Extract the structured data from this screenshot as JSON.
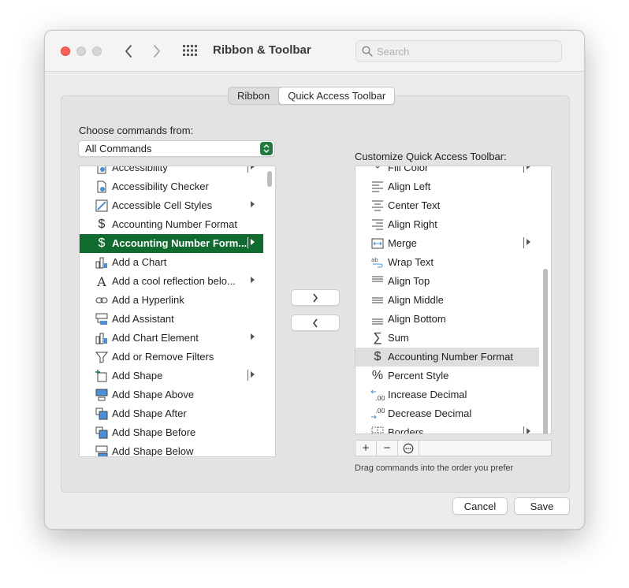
{
  "window": {
    "title": "Ribbon & Toolbar",
    "search_placeholder": "Search"
  },
  "tabs": [
    {
      "label": "Ribbon",
      "active": false
    },
    {
      "label": "Quick Access Toolbar",
      "active": true
    }
  ],
  "left": {
    "choose_label": "Choose commands from:",
    "selected_source": "All Commands",
    "items": [
      {
        "label": "Accessibility",
        "icon": "accessibility-icon",
        "submenu": "bar"
      },
      {
        "label": "Accessibility Checker",
        "icon": "accessibility-checker-icon",
        "submenu": "none"
      },
      {
        "label": "Accessible Cell Styles",
        "icon": "cell-styles-icon",
        "submenu": "arrow"
      },
      {
        "label": "Accounting Number Format",
        "icon": "dollar-icon",
        "submenu": "none"
      },
      {
        "label": "Accounting Number Form...",
        "icon": "dollar-icon",
        "submenu": "bar",
        "selected": true
      },
      {
        "label": "Add a Chart",
        "icon": "chart-icon",
        "submenu": "none"
      },
      {
        "label": "Add a cool reflection belo...",
        "icon": "text-effects-icon",
        "submenu": "arrow"
      },
      {
        "label": "Add a Hyperlink",
        "icon": "hyperlink-icon",
        "submenu": "none"
      },
      {
        "label": "Add Assistant",
        "icon": "assistant-icon",
        "submenu": "none"
      },
      {
        "label": "Add Chart Element",
        "icon": "chart-element-icon",
        "submenu": "arrow"
      },
      {
        "label": "Add or Remove Filters",
        "icon": "filter-icon",
        "submenu": "none"
      },
      {
        "label": "Add Shape",
        "icon": "add-shape-icon",
        "submenu": "bar"
      },
      {
        "label": "Add Shape Above",
        "icon": "shape-above-icon",
        "submenu": "none"
      },
      {
        "label": "Add Shape After",
        "icon": "shape-after-icon",
        "submenu": "none"
      },
      {
        "label": "Add Shape Before",
        "icon": "shape-before-icon",
        "submenu": "none"
      },
      {
        "label": "Add Shape Below",
        "icon": "shape-below-icon",
        "submenu": "none"
      }
    ]
  },
  "right": {
    "customize_label": "Customize Quick Access Toolbar:",
    "items": [
      {
        "label": "Fill Color",
        "icon": "fill-color-icon",
        "submenu": "bar"
      },
      {
        "label": "Align Left",
        "icon": "align-left-icon",
        "submenu": "none"
      },
      {
        "label": "Center Text",
        "icon": "center-text-icon",
        "submenu": "none"
      },
      {
        "label": "Align Right",
        "icon": "align-right-icon",
        "submenu": "none"
      },
      {
        "label": "Merge",
        "icon": "merge-icon",
        "submenu": "bar"
      },
      {
        "label": "Wrap Text",
        "icon": "wrap-text-icon",
        "submenu": "none"
      },
      {
        "label": "Align Top",
        "icon": "align-top-icon",
        "submenu": "none"
      },
      {
        "label": "Align Middle",
        "icon": "align-middle-icon",
        "submenu": "none"
      },
      {
        "label": "Align Bottom",
        "icon": "align-bottom-icon",
        "submenu": "none"
      },
      {
        "label": "Sum",
        "icon": "sum-icon",
        "submenu": "none"
      },
      {
        "label": "Accounting Number Format",
        "icon": "dollar-icon",
        "submenu": "none",
        "highlighted": true
      },
      {
        "label": "Percent Style",
        "icon": "percent-icon",
        "submenu": "none"
      },
      {
        "label": "Increase Decimal",
        "icon": "increase-decimal-icon",
        "submenu": "none"
      },
      {
        "label": "Decrease Decimal",
        "icon": "decrease-decimal-icon",
        "submenu": "none"
      },
      {
        "label": "Borders",
        "icon": "borders-icon",
        "submenu": "bar"
      }
    ],
    "hint": "Drag commands into the order you prefer"
  },
  "buttons": {
    "cancel": "Cancel",
    "save": "Save"
  },
  "colors": {
    "selection": "#0f6b2e",
    "close": "#ff5f57"
  }
}
